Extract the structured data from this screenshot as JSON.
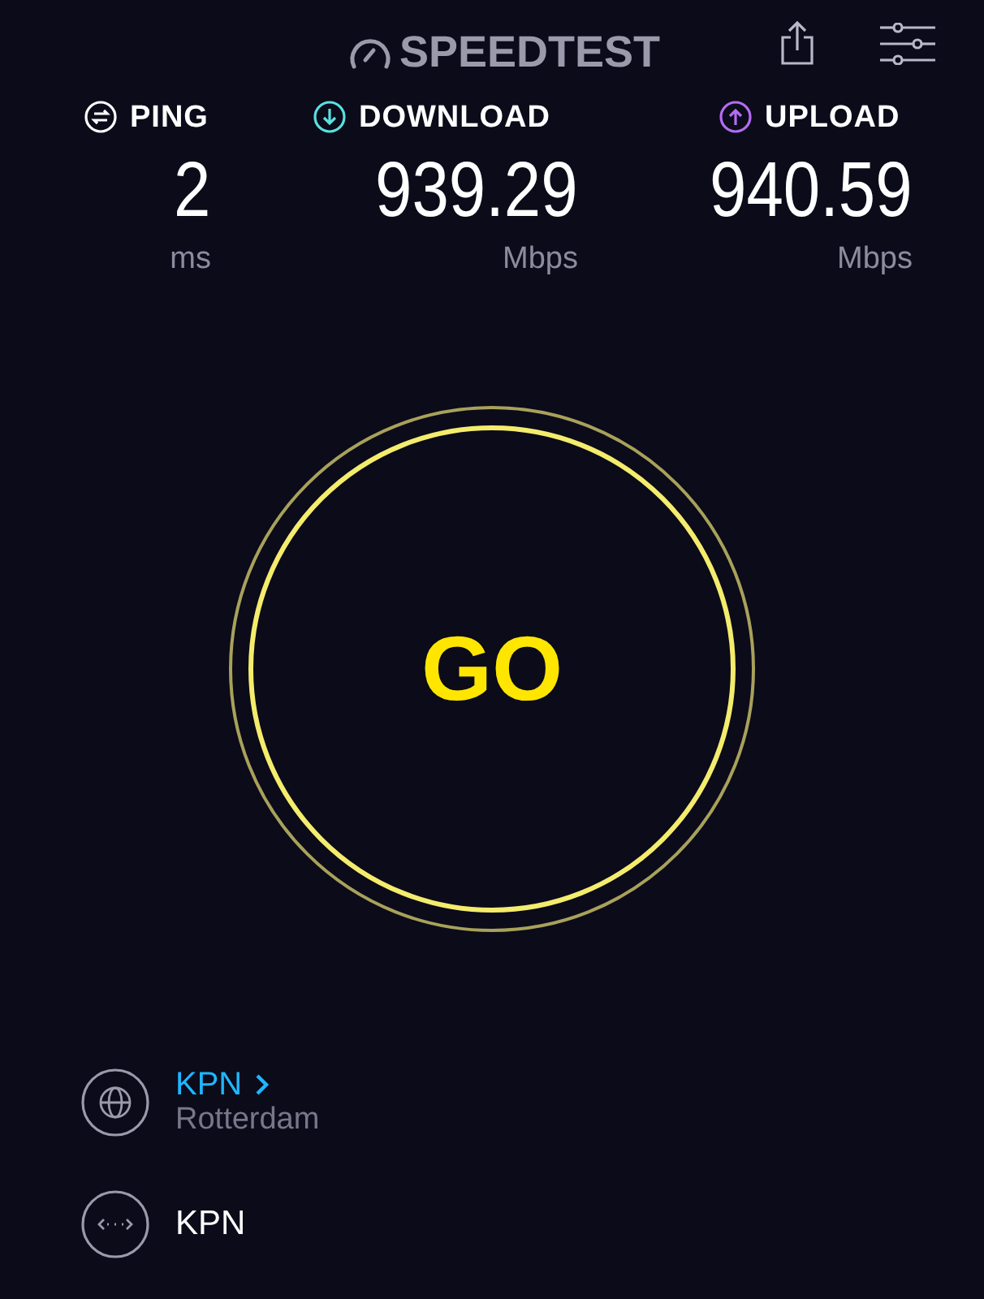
{
  "header": {
    "logo": "SPEEDTEST"
  },
  "metrics": [
    {
      "kind": "ping",
      "label": "PING",
      "value": "2",
      "unit": "ms",
      "color": "#ffffff"
    },
    {
      "kind": "download",
      "label": "DOWNLOAD",
      "value": "939.29",
      "unit": "Mbps",
      "color": "#5ae0e0"
    },
    {
      "kind": "upload",
      "label": "UPLOAD",
      "value": "940.59",
      "unit": "Mbps",
      "color": "#b36cf2"
    }
  ],
  "go_button": {
    "label": "GO"
  },
  "server": {
    "provider": "KPN",
    "location": "Rotterdam"
  },
  "connection": {
    "provider": "KPN"
  }
}
